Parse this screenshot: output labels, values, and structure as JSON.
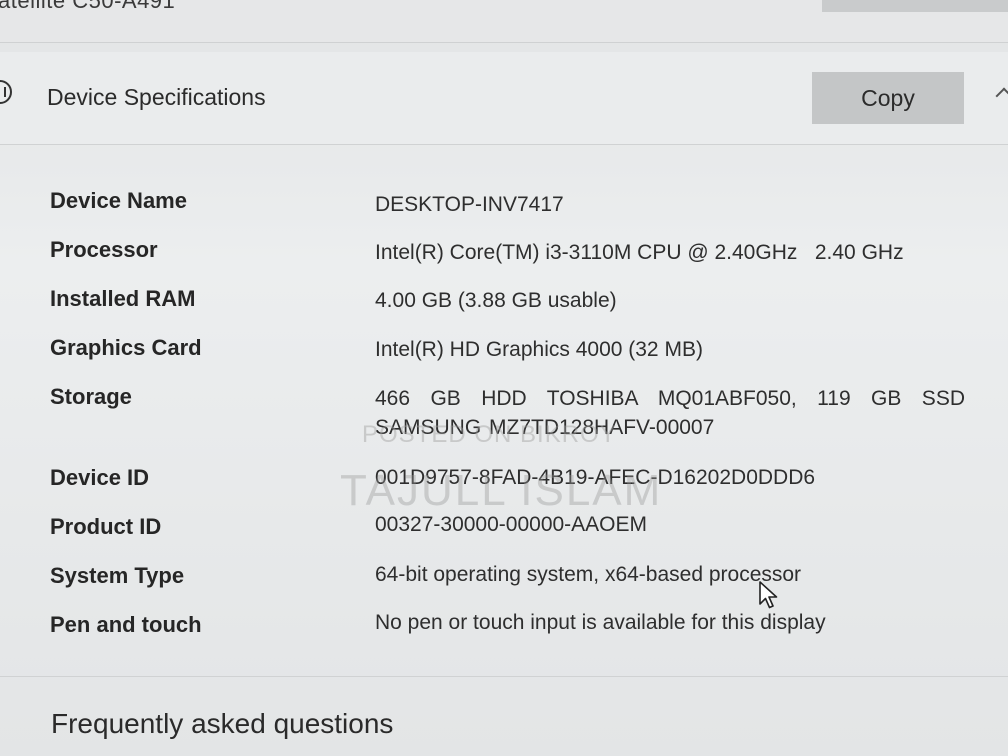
{
  "top_strip": {
    "partial_title": "atellite C50-A491"
  },
  "header": {
    "title": "Device Specifications",
    "copy_label": "Copy"
  },
  "specs": [
    {
      "label": "Device Name",
      "value": "DESKTOP-INV7417"
    },
    {
      "label": "Processor",
      "value": "Intel(R) Core(TM) i3-3110M CPU @ 2.40GHz   2.40 GHz"
    },
    {
      "label": "Installed RAM",
      "value": "4.00 GB (3.88 GB usable)"
    },
    {
      "label": "Graphics Card",
      "value": "Intel(R) HD Graphics 4000 (32 MB)"
    },
    {
      "label": "Storage",
      "value": "466 GB HDD TOSHIBA MQ01ABF050, 119 GB SSD SAMSUNG MZ7TD128HAFV-00007"
    },
    {
      "label": "Device ID",
      "value": "001D9757-8FAD-4B19-AFEC-D16202D0DDD6"
    },
    {
      "label": "Product ID",
      "value": "00327-30000-00000-AAOEM"
    },
    {
      "label": "System Type",
      "value": "64-bit operating system, x64-based processor"
    },
    {
      "label": "Pen and touch",
      "value": "No pen or touch input is available for this display"
    }
  ],
  "watermarks": {
    "small": "POSTED ON BIKROY",
    "large": "TAJULL ISLAM"
  },
  "faq": {
    "title": "Frequently asked questions"
  },
  "icons": {
    "info": "info-icon",
    "cursor": "mouse-pointer-icon",
    "chevron": "chevron-up-icon"
  }
}
